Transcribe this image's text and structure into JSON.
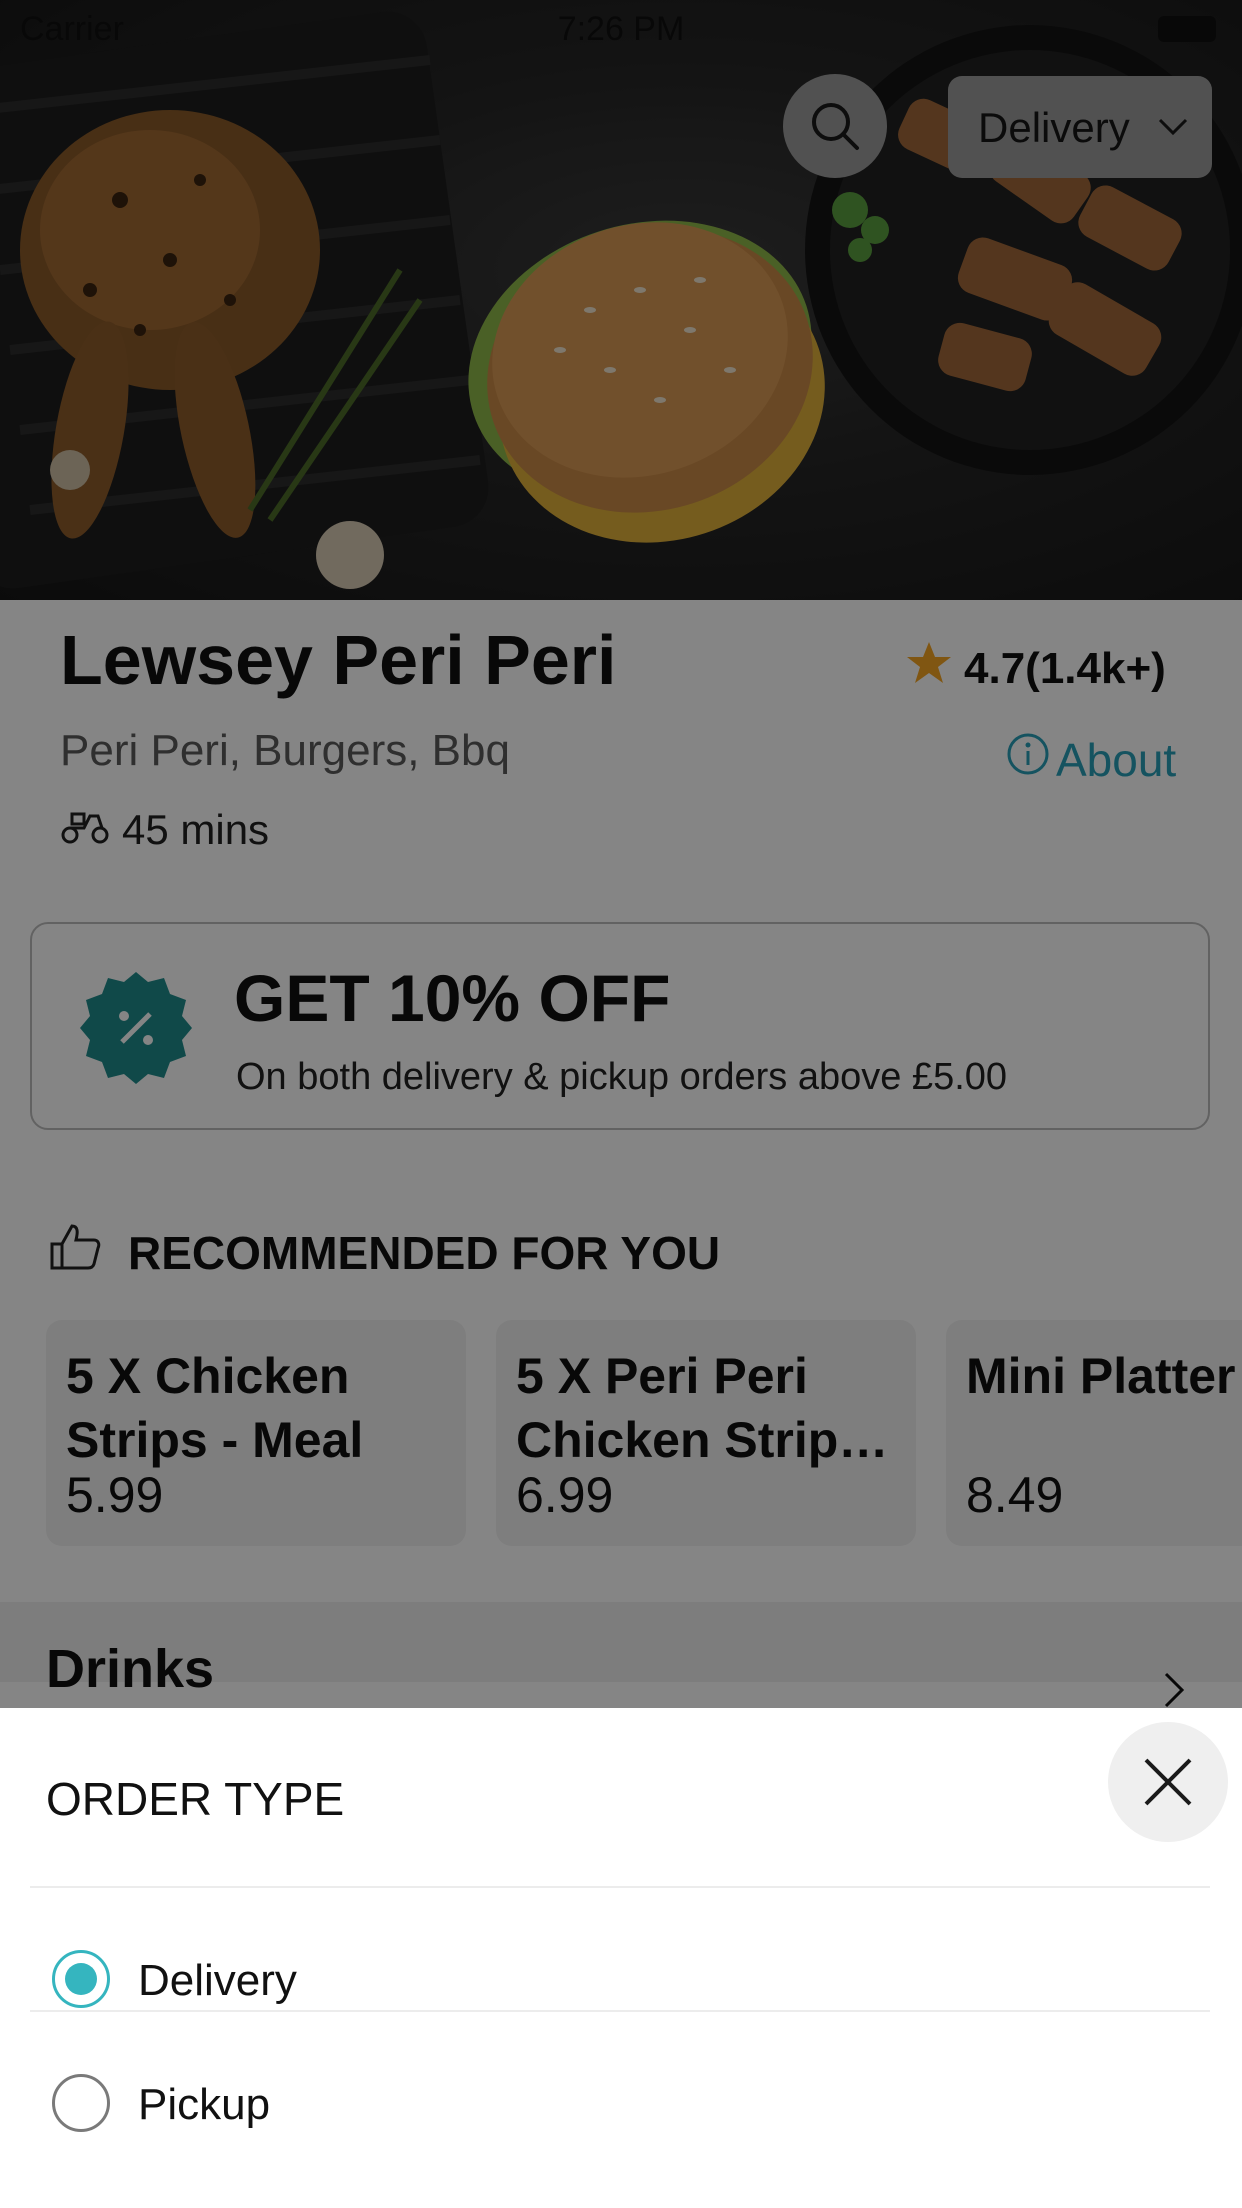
{
  "status_bar": {
    "carrier": "Carrier",
    "time": "7:26 PM"
  },
  "header": {
    "search_icon": "search-icon",
    "order_type_selected": "Delivery",
    "dropdown_icon": "chevron-down-icon"
  },
  "restaurant": {
    "name": "Lewsey Peri Peri",
    "rating": "4.7(1.4k+)",
    "cuisines": "Peri Peri, Burgers, Bbq",
    "about_label": "About",
    "delivery_time": "45 mins"
  },
  "offer": {
    "title": "GET 10% OFF",
    "description": "On both delivery & pickup orders above £5.00"
  },
  "recommended": {
    "heading": "RECOMMENDED FOR YOU",
    "items": [
      {
        "name": "5 X Chicken Strips - Meal",
        "price": "5.99"
      },
      {
        "name": "5 X Peri Peri Chicken Strip…",
        "price": "6.99"
      },
      {
        "name": "Mini Platter",
        "price": "8.49"
      }
    ]
  },
  "menu_section": {
    "title": "Drinks"
  },
  "sheet": {
    "title": "ORDER TYPE",
    "options": [
      {
        "label": "Delivery",
        "selected": true
      },
      {
        "label": "Pickup",
        "selected": false
      }
    ]
  },
  "colors": {
    "accent": "#35b5bf",
    "link": "#2aa0b8",
    "badge": "#1f8c8c",
    "star": "#f5a623"
  }
}
